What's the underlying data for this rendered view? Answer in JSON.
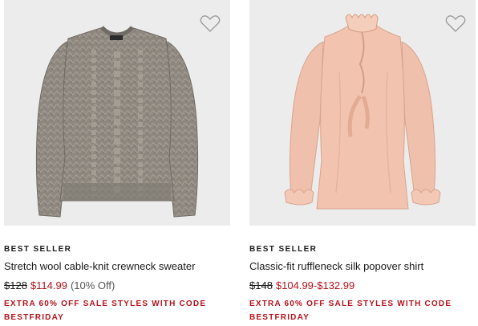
{
  "colors": {
    "sale_red": "#b5121b",
    "image_bg": "#ececec",
    "text": "#1a1a1a"
  },
  "products": [
    {
      "badge": "BEST SELLER",
      "title": "Stretch wool cable-knit crewneck sweater",
      "original_price": "$128",
      "sale_price": "$114.99",
      "discount": "(10% Off)",
      "promo": "EXTRA 60% OFF SALE STYLES WITH CODE BESTFRIDAY",
      "favorite_icon": "heart-outline-icon"
    },
    {
      "badge": "BEST SELLER",
      "title": "Classic-fit ruffleneck silk popover shirt",
      "original_price": "$148",
      "sale_price": "$104.99-$132.99",
      "discount": "",
      "promo": "EXTRA 60% OFF SALE STYLES WITH CODE BESTFRIDAY",
      "favorite_icon": "heart-outline-icon"
    }
  ]
}
